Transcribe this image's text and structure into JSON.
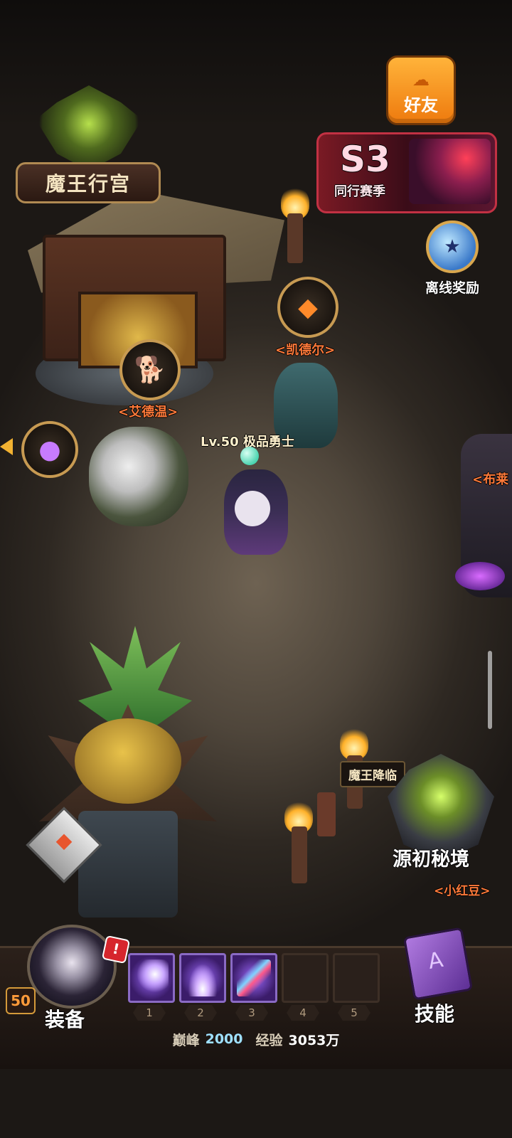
{
  "palace": {
    "sign": "魔王行宫"
  },
  "friends_button": {
    "label": "好友",
    "icon": "cloud-icon"
  },
  "season_banner": {
    "title": "S3",
    "subtitle": "同行赛季"
  },
  "offline_reward": {
    "label": "离线奖励",
    "icon": "moon-star-icon"
  },
  "npcs": [
    {
      "name": "<凯德尔>",
      "icon": "diamond-gem-icon"
    },
    {
      "name": "<艾德温>",
      "icon": "dog-head-icon"
    },
    {
      "name": "",
      "icon": "purple-orb-icon"
    },
    {
      "name": "<布莱",
      "icon": ""
    }
  ],
  "hero": {
    "title": "Lv.50 极品勇士"
  },
  "demon_descent": {
    "tag": "魔王降临",
    "name": "源初秘境",
    "owner": "<小红豆>"
  },
  "hud": {
    "level": "50",
    "equip_label": "装备",
    "skills_label": "技能",
    "alert": "!",
    "skill_slots": [
      {
        "num": "1",
        "filled": true,
        "icon": "comet-icon"
      },
      {
        "num": "2",
        "filled": true,
        "icon": "light-pillar-icon"
      },
      {
        "num": "3",
        "filled": true,
        "icon": "meteor-shower-icon"
      },
      {
        "num": "4",
        "filled": false,
        "icon": ""
      },
      {
        "num": "5",
        "filled": false,
        "icon": ""
      }
    ],
    "peak_label": "巅峰",
    "peak_value": "2000",
    "exp_label": "经验",
    "exp_value": "3053万"
  },
  "colors": {
    "npc_name": "#ff7a3a",
    "friends_orange": "#ee7a0e",
    "season_red": "#c23143",
    "hud_dark": "#18120f"
  }
}
